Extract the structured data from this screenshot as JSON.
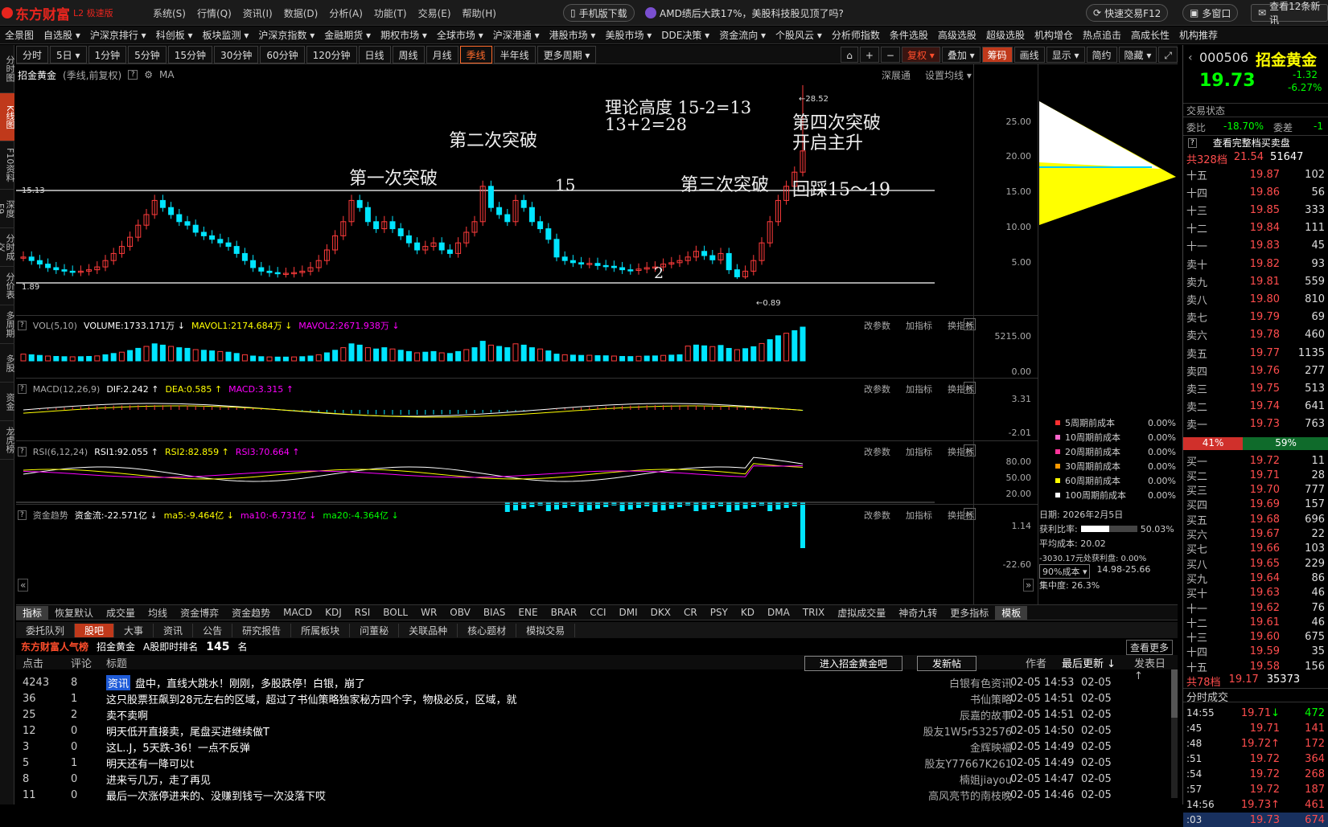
{
  "app": {
    "brand": "东方财富",
    "brand_sub": "L2 极速版"
  },
  "main_menu": [
    "系统(S)",
    "行情(Q)",
    "资讯(I)",
    "数据(D)",
    "分析(A)",
    "功能(T)",
    "交易(E)",
    "帮助(H)"
  ],
  "top_buttons": {
    "mobile": "手机版下载",
    "news": "AMD绩后大跌17%，美股科技股见顶了吗?",
    "quick_trade": "快速交易F12",
    "multi_window": "多窗口",
    "news_count": "查看12条新讯"
  },
  "sec_menu": [
    "全景图",
    "自选股 ▾",
    "沪深京排行 ▾",
    "科创板 ▾",
    "板块监测 ▾",
    "沪深京指数 ▾",
    "金融期货 ▾",
    "期权市场 ▾",
    "全球市场 ▾",
    "沪深港通 ▾",
    "港股市场 ▾",
    "美股市场 ▾",
    "DDE决策 ▾",
    "资金流向 ▾",
    "个股风云 ▾",
    "分析师指数",
    "条件选股",
    "高级选股",
    "超级选股",
    "机构增仓",
    "热点追击",
    "高成长性",
    "机构推荐"
  ],
  "sidebar_tabs": [
    "分时图",
    "K线图",
    "F10资料",
    "深度F9",
    "分时成交",
    "分价表",
    "多周期",
    "多股",
    "资金",
    "龙虎榜"
  ],
  "periods": [
    "分时",
    "5日 ▾",
    "1分钟",
    "5分钟",
    "15分钟",
    "30分钟",
    "60分钟",
    "120分钟",
    "日线",
    "周线",
    "月线",
    "季线",
    "半年线",
    "更多周期 ▾"
  ],
  "active_period": "季线",
  "toolbar": {
    "restore": "复权 ▾",
    "overlay": "叠加 ▾",
    "chip": "筹码",
    "draw": "画线",
    "display": "显示 ▾",
    "simple": "简约",
    "hide": "隐藏 ▾"
  },
  "chart_title": {
    "name": "招金黄金",
    "mode": "(季线,前复权)",
    "ma": "MA",
    "depth": "深展通",
    "setting": "设置均线 ▾"
  },
  "annotations": {
    "theory": "理论高度  15-2=13",
    "theory2": "13+2=28",
    "first": "第一次突破",
    "second": "第二次突破",
    "n15": "15",
    "third": "第三次突破",
    "fourth": "第四次突破",
    "fourth2": "开启主升",
    "pullback": "回踩15～19",
    "n2": "2",
    "hi_label": "28.52",
    "lo_label": "0.89",
    "line_upper": "15.13",
    "line_lower": "1.89"
  },
  "main_yaxis": [
    "25.00",
    "20.00",
    "15.00",
    "10.00",
    "5.00"
  ],
  "vol": {
    "name": "VOL(5,10)",
    "volume": "VOLUME:1733.171万 ↓",
    "mavol1": "MAVOL1:2174.684万 ↓",
    "mavol2": "MAVOL2:2671.938万 ↓",
    "y_top": "5215.00",
    "y_bottom": "0.00"
  },
  "macd": {
    "name": "MACD(12,26,9)",
    "dif": "DIF:2.242 ↑",
    "dea": "DEA:0.585 ↑",
    "macd": "MACD:3.315 ↑",
    "y_top": "3.31",
    "y_bottom": "-2.01"
  },
  "rsi": {
    "name": "RSI(6,12,24)",
    "rsi1": "RSI1:92.055 ↑",
    "rsi2": "RSI2:82.859 ↑",
    "rsi3": "RSI3:70.664 ↑",
    "y": [
      "80.00",
      "50.00",
      "20.00"
    ]
  },
  "fund": {
    "name": "资金趋势",
    "flow": "资金流:-22.571亿 ↓",
    "ma5": "ma5:-9.464亿 ↓",
    "ma10": "ma10:-6.731亿 ↓",
    "ma20": "ma20:-4.364亿 ↓",
    "y_top": "1.14",
    "y_bottom": "-22.60"
  },
  "ind_controls": [
    "改参数",
    "加指标",
    "换指标"
  ],
  "cost": {
    "items": [
      {
        "label": "5周期前成本",
        "pct": "0.00%",
        "color": "#ff3030"
      },
      {
        "label": "10周期前成本",
        "pct": "0.00%",
        "color": "#ff66cc"
      },
      {
        "label": "20周期前成本",
        "pct": "0.00%",
        "color": "#ff3399"
      },
      {
        "label": "30周期前成本",
        "pct": "0.00%",
        "color": "#ff9900"
      },
      {
        "label": "60周期前成本",
        "pct": "0.00%",
        "color": "#ffff00"
      },
      {
        "label": "100周期前成本",
        "pct": "0.00%",
        "color": "#ffffff"
      }
    ],
    "date": "日期: 2026年2月5日",
    "profit_ratio_label": "获利比率:",
    "profit_ratio": "50.03%",
    "avg_cost": "平均成本: 20.02",
    "extra": "-3030.17元处获利盘: 0.00%",
    "range_select": "90%成本 ▾",
    "range": "14.98-25.66",
    "concentration": "集中度: 26.3%"
  },
  "indicator_tabs": [
    "指标",
    "恢复默认",
    "成交量",
    "均线",
    "资金博弈",
    "资金趋势",
    "MACD",
    "KDJ",
    "RSI",
    "BOLL",
    "WR",
    "OBV",
    "BIAS",
    "ENE",
    "BRAR",
    "CCI",
    "DMI",
    "DKX",
    "CR",
    "PSY",
    "KD",
    "DMA",
    "TRIX",
    "虚拟成交量",
    "神奇九转",
    "更多指标",
    "模板"
  ],
  "info_tabs": [
    "委托队列",
    "股吧",
    "大事",
    "资讯",
    "公告",
    "研究报告",
    "所属板块",
    "问董秘",
    "关联品种",
    "核心题材",
    "模拟交易"
  ],
  "forum": {
    "brand": "东方财富人气榜",
    "stock": "招金黄金",
    "rank_label": "A股即时排名",
    "rank": "145",
    "rank_unit": "名",
    "view_more": "查看更多",
    "enter": "进入招金黄金吧",
    "post_btn": "发新帖",
    "cols": {
      "clicks": "点击",
      "comments": "评论",
      "title": "标题",
      "author": "作者",
      "updated": "最后更新 ↓",
      "posted": "发表日 ↑"
    },
    "posts": [
      {
        "clicks": "4243",
        "comments": "8",
        "tag": "资讯",
        "title": "盘中，直线大跳水！刚刚，多股跌停！白银，崩了",
        "author": "白银有色资讯",
        "updated": "02-05 14:53",
        "posted": "02-05"
      },
      {
        "clicks": "36",
        "comments": "1",
        "tag": "",
        "title": "这只股票狂飙到28元左右的区域，超过了书仙策略独家秘方四个字，物极必反，区域，就",
        "author": "书仙策略",
        "updated": "02-05 14:51",
        "posted": "02-05"
      },
      {
        "clicks": "25",
        "comments": "2",
        "tag": "",
        "title": "卖不卖啊",
        "author": "辰嘉的故事",
        "updated": "02-05 14:51",
        "posted": "02-05"
      },
      {
        "clicks": "12",
        "comments": "0",
        "tag": "",
        "title": "明天低开直接卖，尾盘买进继续做T",
        "author": "股友1W5r532576",
        "updated": "02-05 14:50",
        "posted": "02-05"
      },
      {
        "clicks": "3",
        "comments": "0",
        "tag": "",
        "title": "这L..J，5天跌-36！一点不反弹",
        "author": "金辉映福",
        "updated": "02-05 14:49",
        "posted": "02-05"
      },
      {
        "clicks": "5",
        "comments": "1",
        "tag": "",
        "title": "明天还有一降可以t",
        "author": "股友Y77667K261",
        "updated": "02-05 14:49",
        "posted": "02-05"
      },
      {
        "clicks": "8",
        "comments": "0",
        "tag": "",
        "title": "进来亏几万，走了再见",
        "author": "楠姐jiayou",
        "updated": "02-05 14:47",
        "posted": "02-05"
      },
      {
        "clicks": "11",
        "comments": "0",
        "tag": "",
        "title": "最后一次涨停进来的、没赚到钱亏一次没落下哎",
        "author": "高风亮节的南枝晚",
        "updated": "02-05 14:46",
        "posted": "02-05"
      }
    ]
  },
  "quote": {
    "code": "000506",
    "name": "招金黄金",
    "price": "19.73",
    "change": "-1.32",
    "change_pct": "-6.27%",
    "trade_state": "交易状态",
    "ratio_label": "委比",
    "ratio": "-18.70%",
    "diff_label": "委差",
    "diff": "-1",
    "full_book": "查看完整档买卖盘",
    "sell_total_label": "共328档",
    "sell_total_price": "21.54",
    "sell_total_vol": "51647",
    "buy_total_label": "共78档",
    "buy_total_price": "19.17",
    "buy_total_vol": "35373",
    "sell_pct": "41%",
    "buy_pct": "59%",
    "sells": [
      {
        "label": "十五",
        "price": "19.87",
        "vol": "102"
      },
      {
        "label": "十四",
        "price": "19.86",
        "vol": "56"
      },
      {
        "label": "十三",
        "price": "19.85",
        "vol": "333"
      },
      {
        "label": "十二",
        "price": "19.84",
        "vol": "111"
      },
      {
        "label": "十一",
        "price": "19.83",
        "vol": "45"
      },
      {
        "label": "卖十",
        "price": "19.82",
        "vol": "93"
      },
      {
        "label": "卖九",
        "price": "19.81",
        "vol": "559"
      },
      {
        "label": "卖八",
        "price": "19.80",
        "vol": "810"
      },
      {
        "label": "卖七",
        "price": "19.79",
        "vol": "69"
      },
      {
        "label": "卖六",
        "price": "19.78",
        "vol": "460"
      },
      {
        "label": "卖五",
        "price": "19.77",
        "vol": "1135"
      },
      {
        "label": "卖四",
        "price": "19.76",
        "vol": "277"
      },
      {
        "label": "卖三",
        "price": "19.75",
        "vol": "513"
      },
      {
        "label": "卖二",
        "price": "19.74",
        "vol": "641"
      },
      {
        "label": "卖一",
        "price": "19.73",
        "vol": "763"
      }
    ],
    "buys": [
      {
        "label": "买一",
        "price": "19.72",
        "vol": "11"
      },
      {
        "label": "买二",
        "price": "19.71",
        "vol": "28"
      },
      {
        "label": "买三",
        "price": "19.70",
        "vol": "777"
      },
      {
        "label": "买四",
        "price": "19.69",
        "vol": "157"
      },
      {
        "label": "买五",
        "price": "19.68",
        "vol": "696"
      },
      {
        "label": "买六",
        "price": "19.67",
        "vol": "22"
      },
      {
        "label": "买七",
        "price": "19.66",
        "vol": "103"
      },
      {
        "label": "买八",
        "price": "19.65",
        "vol": "229"
      },
      {
        "label": "买九",
        "price": "19.64",
        "vol": "86"
      },
      {
        "label": "买十",
        "price": "19.63",
        "vol": "46"
      },
      {
        "label": "十一",
        "price": "19.62",
        "vol": "76"
      },
      {
        "label": "十二",
        "price": "19.61",
        "vol": "46"
      },
      {
        "label": "十三",
        "price": "19.60",
        "vol": "675"
      },
      {
        "label": "十四",
        "price": "19.59",
        "vol": "35"
      },
      {
        "label": "十五",
        "price": "19.58",
        "vol": "156"
      }
    ],
    "ticks_title": "分时成交",
    "ticks": [
      {
        "time": "14:55",
        "price": "19.71",
        "arrow": "↓",
        "vol": "472"
      },
      {
        "time": ":45",
        "price": "19.71",
        "arrow": "",
        "vol": "141"
      },
      {
        "time": ":48",
        "price": "19.72",
        "arrow": "↑",
        "vol": "172"
      },
      {
        "time": ":51",
        "price": "19.72",
        "arrow": "",
        "vol": "364"
      },
      {
        "time": ":54",
        "price": "19.72",
        "arrow": "",
        "vol": "268"
      },
      {
        "time": ":57",
        "price": "19.72",
        "arrow": "",
        "vol": "187"
      },
      {
        "time": "14:56",
        "price": "19.73",
        "arrow": "↑",
        "vol": "461"
      },
      {
        "time": ":03",
        "price": "19.73",
        "arrow": "",
        "vol": "674"
      }
    ]
  },
  "colors": {
    "up": "#ff3b3b",
    "down": "#00e5ff",
    "accent": "#c0391b"
  }
}
